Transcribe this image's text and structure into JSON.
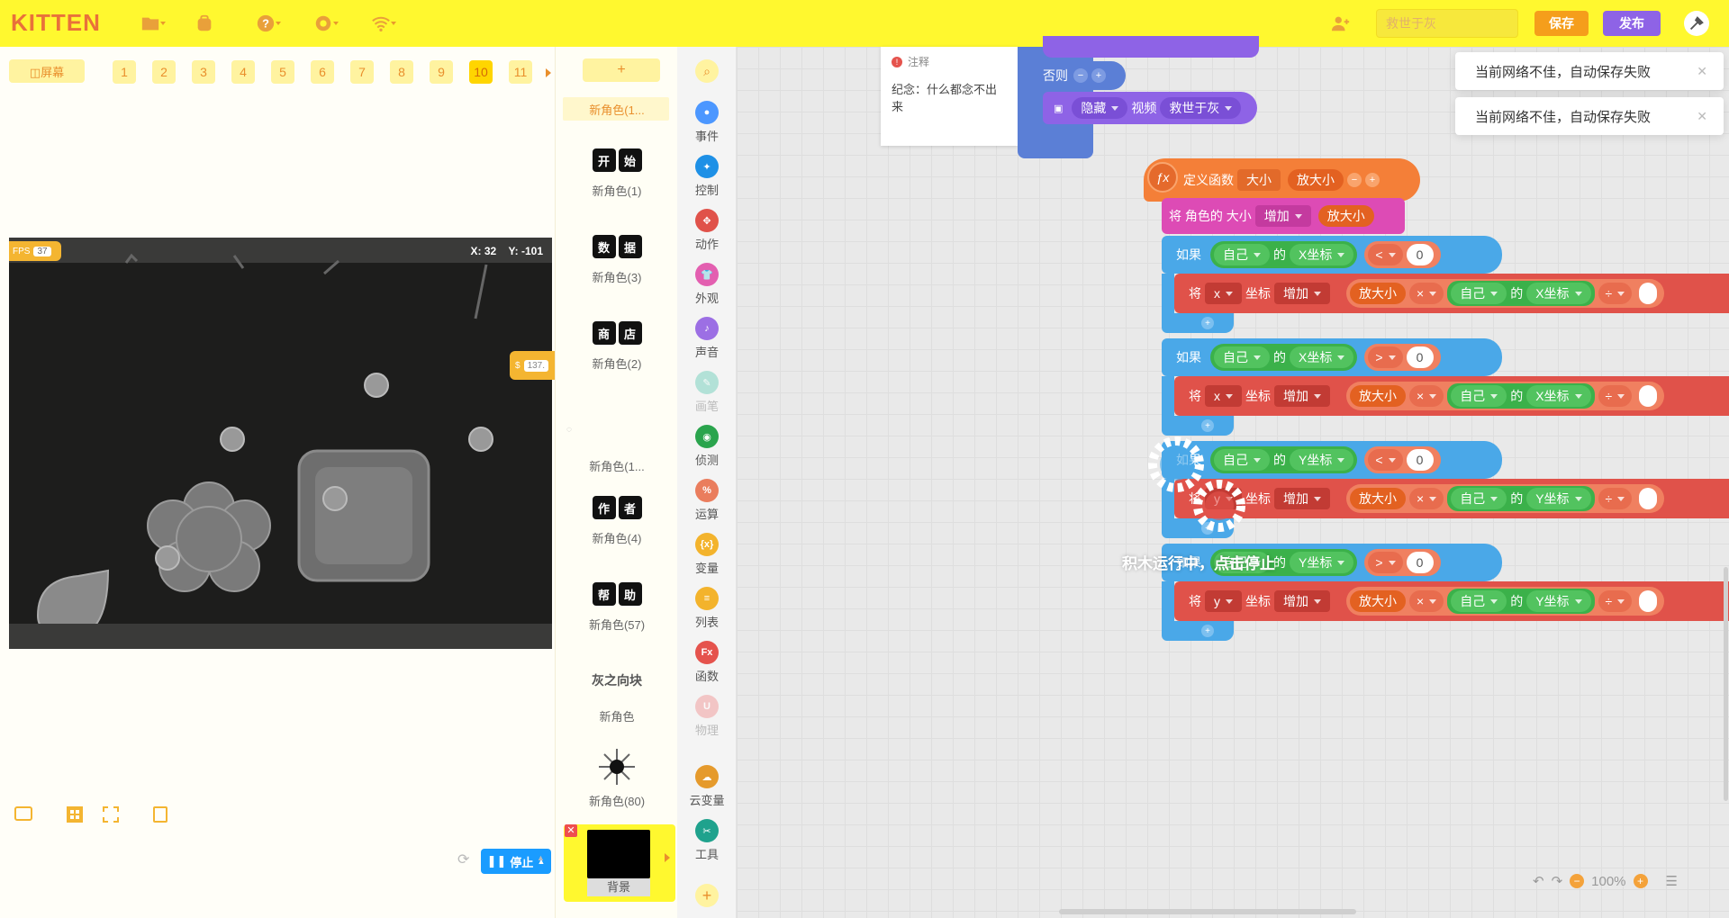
{
  "header": {
    "logo": "KITTEN",
    "search_placeholder": "救世于灰",
    "save": "保存",
    "publish": "发布"
  },
  "scenes": {
    "fullscreen": "◫屏幕",
    "numbers": [
      "1",
      "2",
      "3",
      "4",
      "5",
      "6",
      "7",
      "8",
      "9",
      "10",
      "11"
    ],
    "active": "10"
  },
  "stage": {
    "fps_label": "FPS",
    "fps_value": "37",
    "x": "X: 32",
    "y": "Y: -101",
    "var_label": "$",
    "var_value": "137."
  },
  "stage_tools": {
    "stop": "停止"
  },
  "sprites": {
    "add": "+",
    "items": [
      {
        "thumb": [],
        "name": "新角色(1..."
      },
      {
        "thumb": [
          "开",
          "始"
        ],
        "name": "新角色(1)"
      },
      {
        "thumb": [
          "数",
          "据"
        ],
        "name": "新角色(3)"
      },
      {
        "thumb": [
          "商",
          "店"
        ],
        "name": "新角色(2)"
      },
      {
        "thumb": [],
        "name": "新角色(1..."
      },
      {
        "thumb": [
          "作",
          "者"
        ],
        "name": "新角色(4)"
      },
      {
        "thumb": [
          "帮",
          "助"
        ],
        "name": "新角色(57)"
      },
      {
        "thumb": [
          "灰之向块"
        ],
        "name": "新角色"
      },
      {
        "thumb": [],
        "name": "新角色(80)"
      }
    ],
    "background": "背景"
  },
  "categories": [
    {
      "label": "事件",
      "color": "#4c97ff",
      "icon": "●"
    },
    {
      "label": "控制",
      "color": "#1e90e6",
      "icon": "✦"
    },
    {
      "label": "动作",
      "color": "#e0524a",
      "icon": "✥"
    },
    {
      "label": "外观",
      "color": "#e35fb0",
      "icon": "👕"
    },
    {
      "label": "声音",
      "color": "#9c6fe4",
      "icon": "♪"
    },
    {
      "label": "画笔",
      "color": "#7dd3c0",
      "icon": "✎"
    },
    {
      "label": "侦测",
      "color": "#2aa44d",
      "icon": "◉"
    },
    {
      "label": "运算",
      "color": "#ea7d5d",
      "icon": "%"
    },
    {
      "label": "变量",
      "color": "#f3b32c",
      "icon": "{x}"
    },
    {
      "label": "列表",
      "color": "#f3b32c",
      "icon": "≡"
    },
    {
      "label": "函数",
      "color": "#e5534d",
      "icon": "Fx"
    },
    {
      "label": "物理",
      "color": "#f2a0a0",
      "icon": "U"
    },
    {
      "label": "云变量",
      "color": "#e59a2c",
      "icon": "☁"
    },
    {
      "label": "工具",
      "color": "#1fa28d",
      "icon": "✂"
    }
  ],
  "toasts": [
    "当前网络不佳，自动保存失败",
    "当前网络不佳，自动保存失败"
  ],
  "note": {
    "title": "注释",
    "text": "纪念：什么都念不出来"
  },
  "blocks": {
    "else": "否则",
    "hide": "隐藏",
    "video": "视频",
    "video_name": "救世于灰",
    "define": "定义函数",
    "size": "大小",
    "param": "放大小",
    "set_size": "将 角色的 大小",
    "increase": "增加",
    "if": "如果",
    "self": "自己",
    "of": "的",
    "xcoord": "X坐标",
    "ycoord": "Y坐标",
    "lt": "<",
    "gt": ">",
    "zero": "0",
    "set": "将",
    "x": "x",
    "y": "y",
    "coord": "坐标",
    "times": "×",
    "div": "÷",
    "plus": "+"
  },
  "running": {
    "text1": "积木运行中，",
    "text2": "点击停止"
  },
  "zoom": "100%"
}
